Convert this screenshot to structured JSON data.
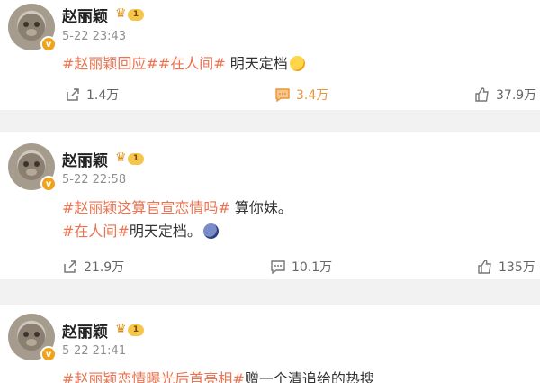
{
  "posts": [
    {
      "author": "赵丽颖",
      "level": "1",
      "time": "5-22 23:43",
      "lines": [
        {
          "tags": [
            "#赵丽颖回应#",
            "#在人间#"
          ],
          "text": " 明天定档"
        }
      ],
      "share_count": "1.4万",
      "comment_count": "3.4万",
      "like_count": "37.9万",
      "comment_active": true
    },
    {
      "author": "赵丽颖",
      "level": "1",
      "time": "5-22 22:58",
      "lines": [
        {
          "tags": [
            "#赵丽颖这算官宣恋情吗#"
          ],
          "text": " 算你妹。"
        },
        {
          "tags": [
            "#在人间#"
          ],
          "text": "明天定档。"
        }
      ],
      "share_count": "21.9万",
      "comment_count": "10.1万",
      "like_count": "135万",
      "comment_active": false
    },
    {
      "author": "赵丽颖",
      "level": "1",
      "time": "5-22 21:41",
      "lines": [
        {
          "tags": [
            "#赵丽颖恋情曝光后首亮相#"
          ],
          "text": "赠一个清追给的热搜"
        }
      ]
    }
  ],
  "colors": {
    "tag": "#eb7350",
    "comment_active": "#e8953a",
    "badge": "#f0a21b",
    "gap": "#f2f2f2"
  },
  "icons": [
    "share-icon",
    "comment-icon",
    "like-icon",
    "verified-v-icon",
    "crown-icon"
  ]
}
